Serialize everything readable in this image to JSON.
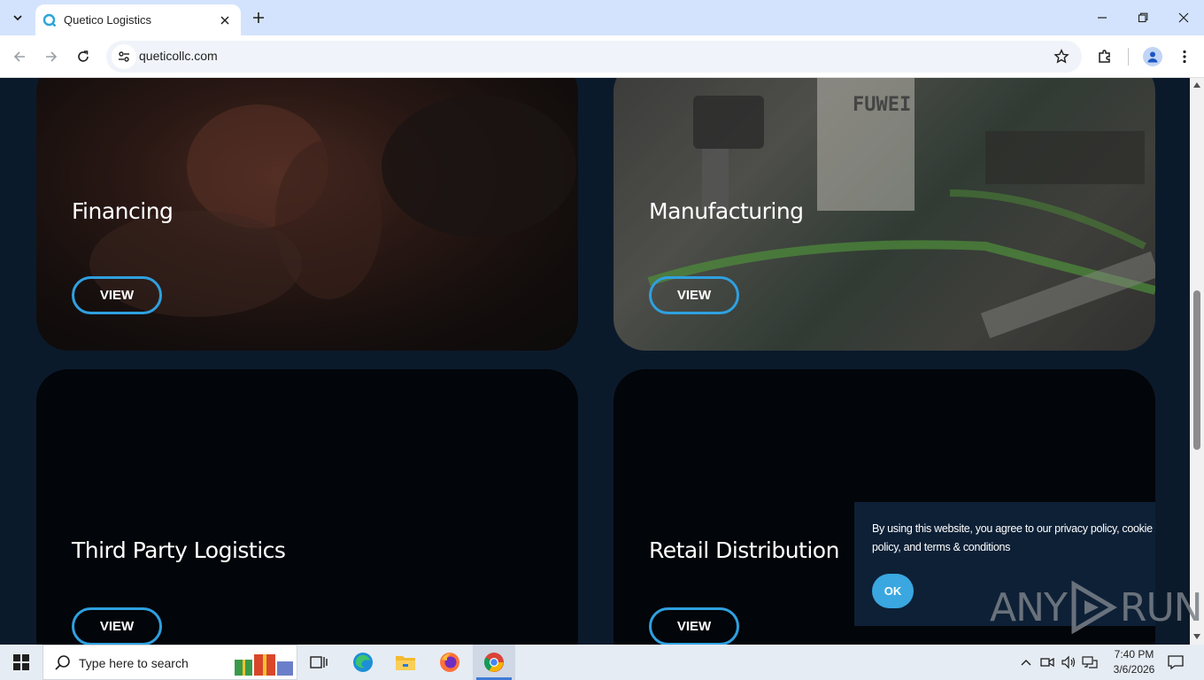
{
  "browser": {
    "tab_title": "Quetico Logistics",
    "url": "queticollc.com"
  },
  "page": {
    "cards": [
      {
        "title": "Financing",
        "button": "VIEW"
      },
      {
        "title": "Manufacturing",
        "button": "VIEW"
      },
      {
        "title": "Third Party Logistics",
        "button": "VIEW"
      },
      {
        "title": "Retail Distribution",
        "button": "VIEW"
      }
    ],
    "machine_brand": "FUWEI"
  },
  "cookie_banner": {
    "message": "By using this website, you agree to our privacy policy, cookie policy, and terms & conditions",
    "ok_label": "OK"
  },
  "watermark": {
    "left": "ANY",
    "right": "RUN"
  },
  "taskbar": {
    "search_placeholder": "Type here to search",
    "time": "7:40 PM",
    "date": "3/6/2026"
  },
  "colors": {
    "accent": "#2fa0e0",
    "page_bg": "#0b1a2b",
    "tabstrip_bg": "#d3e3fd"
  }
}
